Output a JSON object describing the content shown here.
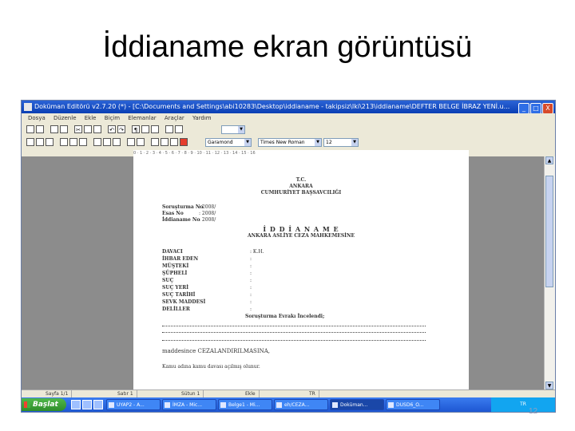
{
  "slide": {
    "title": "İddianame ekran görüntüsü",
    "number": "12"
  },
  "window": {
    "title": "Doküman Editörü v2.7.20 (*) - [C:\\Documents and Settings\\abi10283\\Desktop\\iddianame - takipsiz\\Iki\\213\\iddianame\\DEFTER BELGE İBRAZ YENİ.u...",
    "buttons": [
      "_",
      "□",
      "X"
    ]
  },
  "menu": [
    "Dosya",
    "Düzenle",
    "Ekle",
    "Biçim",
    "Elemanlar",
    "Araçlar",
    "Yardım"
  ],
  "toolbar": {
    "font_family": "Garamond",
    "font_style": "Times New Roman",
    "font_size": "12",
    "icons": [
      "new-icon",
      "open-icon",
      "save-icon",
      "print-icon",
      "cut-icon",
      "copy-icon",
      "paste-icon",
      "undo-icon",
      "redo-icon",
      "bold-icon",
      "italic-icon",
      "underline-icon",
      "align-left-icon",
      "align-center-icon",
      "align-right-icon",
      "justify-icon",
      "bullet-list-icon",
      "numbered-list-icon",
      "indent-icon"
    ]
  },
  "ruler": "0 · 1 · 2 · 3 · 4 · 5 · 6 · 7 · 8 · 9 · 10 · 11 · 12 · 13 · 14 · 15 · 16",
  "document": {
    "header1": "T.C.",
    "header2": "ANKARA",
    "header3": "CUMHURİYET BAŞSAVCILIĞI",
    "meta": [
      {
        "label": "Soruşturma No",
        "value": ": 2008/"
      },
      {
        "label": "Esas No",
        "value": ": 2008/"
      },
      {
        "label": "İddianame No",
        "value": ": 2008/"
      }
    ],
    "doc_title": "İ D D İ A N A M E",
    "court": "ANKARA ASLİYE CEZA MAHKEMESİNE",
    "fields": [
      {
        "label": "DAVACI",
        "value": ": K.H."
      },
      {
        "label": "İHBAR EDEN",
        "value": ":"
      },
      {
        "label": "MÜŞTEKİ",
        "value": ":"
      },
      {
        "label": "ŞÜPHELİ",
        "value": ":"
      },
      {
        "label": "SUÇ",
        "value": ":"
      },
      {
        "label": "SUÇ YERİ",
        "value": ":"
      },
      {
        "label": "SUÇ TARİHİ",
        "value": ":"
      },
      {
        "label": "SEVK MADDESİ",
        "value": ":"
      },
      {
        "label": "DELİLLER",
        "value": ":"
      }
    ],
    "investigation": "Soruşturma Evrakı İncelendi;",
    "penalty": "maddesince CEZALANDIRILMASINA,",
    "closing": "Kamu adına kamu davası açılmış olunur."
  },
  "status": [
    "Sayfa 1/1",
    "Satır 1",
    "Sütun 1",
    "Ekle",
    "TR"
  ],
  "taskbar": {
    "start": "Başlat",
    "tasks": [
      "UYAP2 - A...",
      "İMZA - Mic...",
      "Belge1 - Mi...",
      "eh/CEZA...",
      "Doküman...",
      "DUSD6_O..."
    ],
    "tray": "TR"
  }
}
